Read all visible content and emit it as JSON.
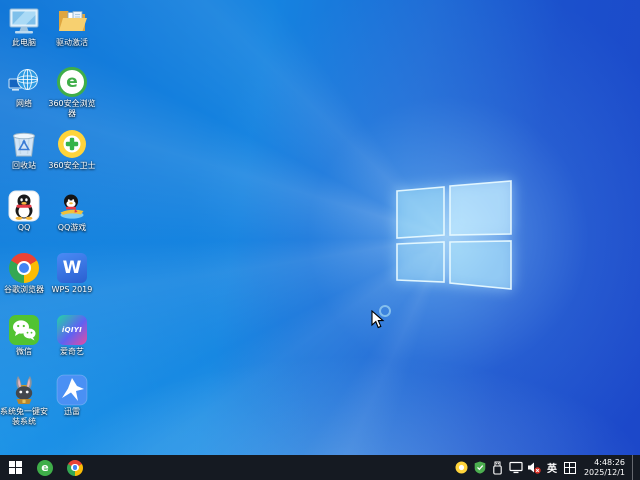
{
  "desktop": {
    "columns": [
      {
        "items": [
          {
            "label": "此电脑",
            "icon": "this-pc-icon"
          },
          {
            "label": "网络",
            "icon": "network-icon"
          },
          {
            "label": "回收站",
            "icon": "recycle-bin-icon"
          },
          {
            "label": "QQ",
            "icon": "qq-icon"
          },
          {
            "label": "谷歌浏览器",
            "icon": "chrome-icon"
          },
          {
            "label": "微信",
            "icon": "wechat-icon"
          },
          {
            "label": "系统兔一键安装系统",
            "icon": "system-rabbit-icon"
          }
        ]
      },
      {
        "items": [
          {
            "label": "驱动激活",
            "icon": "driver-activation-folder-icon"
          },
          {
            "label": "360安全浏览器",
            "icon": "360-safe-browser-icon",
            "icon_text": "e"
          },
          {
            "label": "360安全卫士",
            "icon": "360-security-guard-icon"
          },
          {
            "label": "QQ游戏",
            "icon": "qq-games-icon"
          },
          {
            "label": "WPS 2019",
            "icon": "wps-icon",
            "icon_text": "W"
          },
          {
            "label": "爱奇艺",
            "icon": "iqiyi-icon",
            "icon_text": "iQIYI"
          },
          {
            "label": "迅雷",
            "icon": "thunder-icon"
          }
        ]
      }
    ]
  },
  "taskbar": {
    "pinned": [
      {
        "name": "360-safe-browser",
        "icon_text": "e"
      },
      {
        "name": "chrome"
      }
    ],
    "tray": {
      "language_indicator": "英",
      "time": "4:48:26",
      "date": "2025/12/1"
    }
  },
  "colors": {
    "wallpaper_left": "#1583e0",
    "wallpaper_right": "#1b49cb",
    "wallpaper_bottom_left": "#1a9ae6",
    "logo_glow": "#bfe6fb",
    "taskbar_bg": "#151a22",
    "accent_green_360": "#3fae49",
    "volume_muted_badge": "#d93025"
  }
}
